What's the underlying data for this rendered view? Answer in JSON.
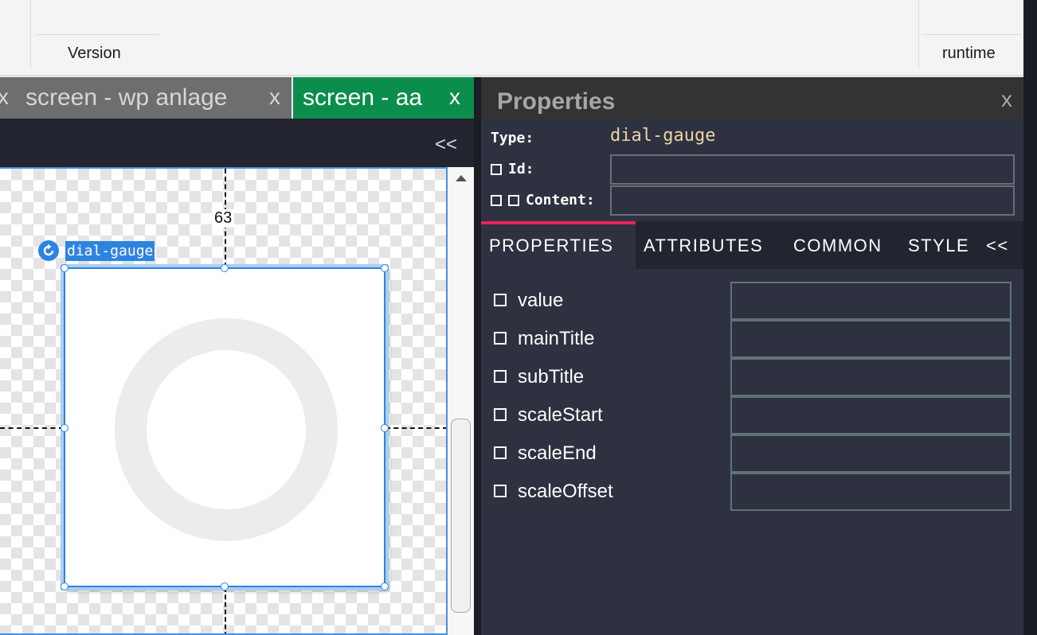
{
  "header": {
    "version_label": "Version",
    "runtime_label": "runtime"
  },
  "tabs": [
    {
      "label": "screen - wp anlage",
      "close": "x",
      "active": false
    },
    {
      "label": "screen - aa",
      "close": "x",
      "active": true
    }
  ],
  "tabs_prev_close": "x",
  "canvas": {
    "collapse_label": "<<",
    "guide_value": "63",
    "widget_label": "dial-gauge",
    "widget_icon": "refresh-icon"
  },
  "properties_panel": {
    "title": "Properties",
    "close": "x",
    "type_label": "Type:",
    "type_value": "dial-gauge",
    "id_label": "Id:",
    "id_value": "",
    "content_label": "Content:",
    "content_value": "",
    "tabs": [
      "PROPERTIES",
      "ATTRIBUTES",
      "COMMON",
      "STYLE"
    ],
    "active_tab": "PROPERTIES",
    "collapse_label": "<<",
    "properties": [
      {
        "name": "value",
        "value": ""
      },
      {
        "name": "mainTitle",
        "value": ""
      },
      {
        "name": "subTitle",
        "value": ""
      },
      {
        "name": "scaleStart",
        "value": ""
      },
      {
        "name": "scaleEnd",
        "value": ""
      },
      {
        "name": "scaleOffset",
        "value": ""
      }
    ]
  },
  "colors": {
    "active_tab": "#0b8d4b",
    "selection": "#2d84e0",
    "tab_indicator": "#e8245a",
    "type_value": "#e9d6a4"
  }
}
